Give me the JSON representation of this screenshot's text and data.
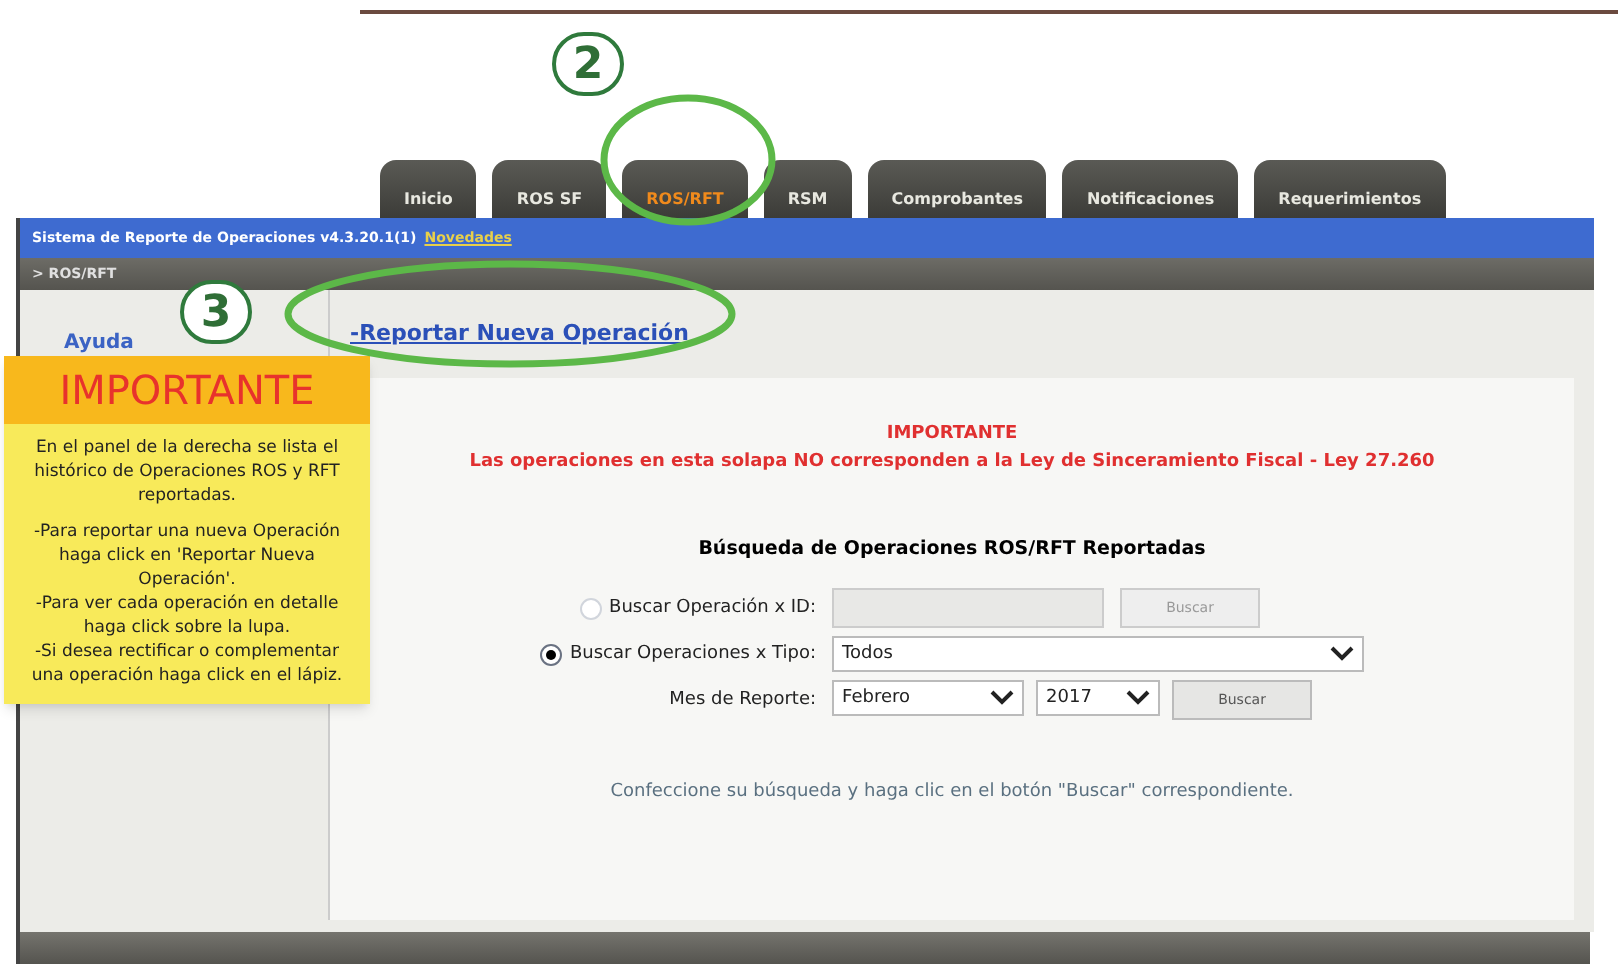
{
  "tabs": [
    {
      "label": "Inicio",
      "selected": false
    },
    {
      "label": "ROS SF",
      "selected": false
    },
    {
      "label": "ROS/RFT",
      "selected": true
    },
    {
      "label": "RSM",
      "selected": false
    },
    {
      "label": "Comprobantes",
      "selected": false
    },
    {
      "label": "Notificaciones",
      "selected": false
    },
    {
      "label": "Requerimientos",
      "selected": false
    }
  ],
  "header": {
    "system": "Sistema de Reporte de Operaciones v4.3.20.1(1)",
    "news_link": "Novedades"
  },
  "breadcrumb": "> ROS/RFT",
  "sidebar": {
    "help_link": "Ayuda"
  },
  "action_link": "-Reportar Nueva Operación",
  "callouts": [
    "2",
    "3"
  ],
  "note": {
    "title": "IMPORTANTE",
    "paragraphs": [
      "En el panel de la derecha se lista el histórico de Operaciones ROS y RFT reportadas.",
      "-Para reportar una nueva Operación haga click en 'Reportar Nueva Operación'.\n-Para ver cada operación en detalle haga click sobre la lupa.\n-Si desea rectificar o complementar una operación haga click en el lápiz."
    ]
  },
  "warning": {
    "title": "IMPORTANTE",
    "text": "Las operaciones en esta solapa NO corresponden a la Ley de Sinceramiento Fiscal - Ley 27.260"
  },
  "search": {
    "title": "Búsqueda de Operaciones ROS/RFT Reportadas",
    "by_id": {
      "label": "Buscar Operación x ID:",
      "selected": false,
      "button": "Buscar",
      "disabled": true
    },
    "by_type": {
      "label": "Buscar Operaciones x Tipo:",
      "selected": true,
      "value": "Todos"
    },
    "month": {
      "label": "Mes de Reporte:",
      "month": "Febrero",
      "year": "2017",
      "button": "Buscar"
    },
    "hint": "Confeccione su búsqueda y haga clic en el botón \"Buscar\" correspondiente."
  }
}
